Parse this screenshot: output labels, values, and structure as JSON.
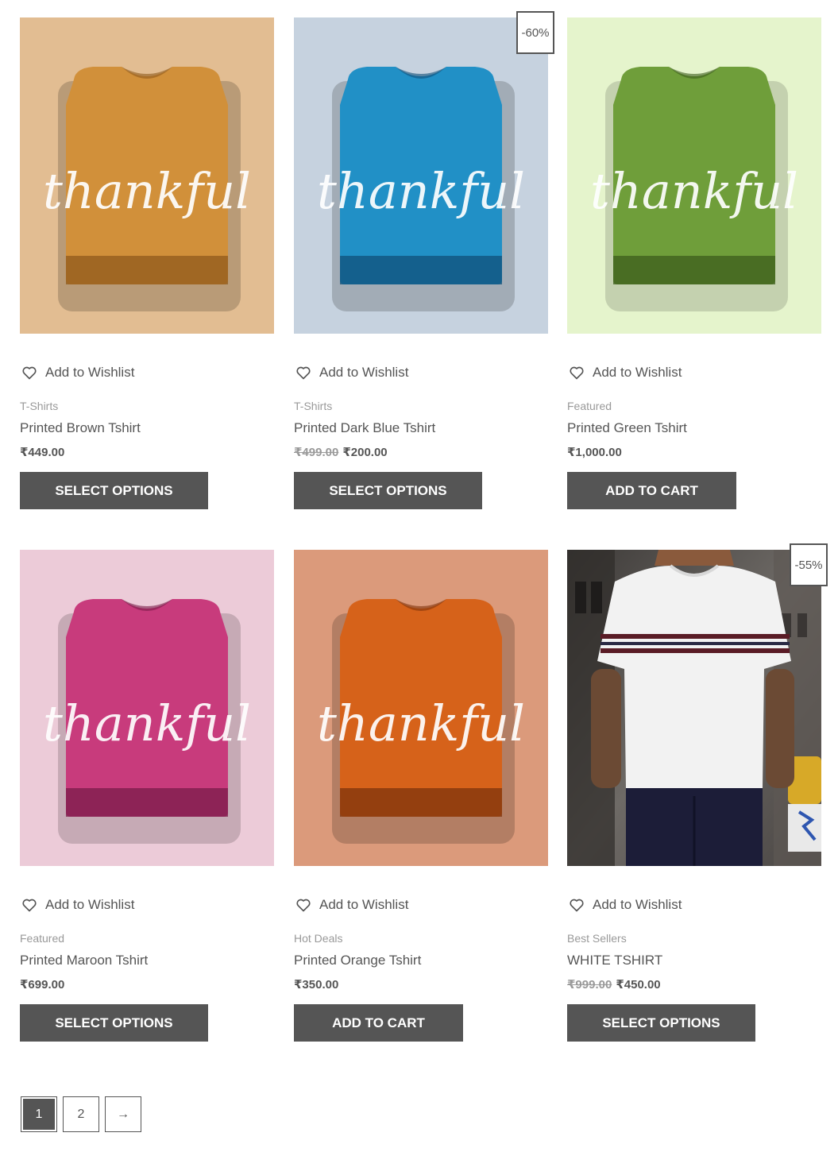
{
  "products": [
    {
      "category": "T-Shirts",
      "title": "Printed Brown Tshirt",
      "old_price": "",
      "price": "₹449.00",
      "button": "SELECT OPTIONS",
      "button_type": "select",
      "badge": "",
      "wishlist": "Add to Wishlist",
      "image": {
        "bg": "#e2bd92",
        "shirt": "#d1903a",
        "shade": "#8f5a1c",
        "print": "thankful"
      }
    },
    {
      "category": "T-Shirts",
      "title": "Printed Dark Blue Tshirt",
      "old_price": "₹499.00",
      "price": "₹200.00",
      "button": "SELECT OPTIONS",
      "button_type": "select",
      "badge": "-60%",
      "wishlist": "Add to Wishlist",
      "image": {
        "bg": "#c6d2df",
        "shirt": "#2190c6",
        "shade": "#10507a",
        "print": "thankful"
      }
    },
    {
      "category": "Featured",
      "title": "Printed Green Tshirt",
      "old_price": "",
      "price": "₹1,000.00",
      "button": "ADD TO CART",
      "button_type": "cart",
      "badge": "",
      "wishlist": "Add to Wishlist",
      "image": {
        "bg": "#e5f4cc",
        "shirt": "#6f9e3a",
        "shade": "#3c5c1c",
        "print": "thankful"
      }
    },
    {
      "category": "Featured",
      "title": "Printed Maroon Tshirt",
      "old_price": "",
      "price": "₹699.00",
      "button": "SELECT OPTIONS",
      "button_type": "select",
      "badge": "",
      "wishlist": "Add to Wishlist",
      "image": {
        "bg": "#eccbd8",
        "shirt": "#c83b7c",
        "shade": "#7a1c4a",
        "print": "thankful"
      }
    },
    {
      "category": "Hot Deals",
      "title": "Printed Orange Tshirt",
      "old_price": "",
      "price": "₹350.00",
      "button": "ADD TO CART",
      "button_type": "cart",
      "badge": "",
      "wishlist": "Add to Wishlist",
      "image": {
        "bg": "#db9a7b",
        "shirt": "#d6621a",
        "shade": "#7e340c",
        "print": "thankful"
      }
    },
    {
      "category": "Best Sellers",
      "title": "WHITE TSHIRT",
      "old_price": "₹999.00",
      "price": "₹450.00",
      "button": "SELECT OPTIONS",
      "button_type": "select",
      "badge": "-55%",
      "wishlist": "Add to Wishlist",
      "image": {
        "bg": "#5a5a5a",
        "shirt": "#f2f2f2",
        "shade": "#cfcfcf",
        "print": "photo"
      }
    }
  ],
  "pagination": {
    "pages": [
      "1",
      "2"
    ],
    "current": "1",
    "next": "→"
  },
  "colors": {
    "button_bg": "#555555",
    "button_text": "#ffffff",
    "text": "#555555",
    "muted": "#999999"
  }
}
